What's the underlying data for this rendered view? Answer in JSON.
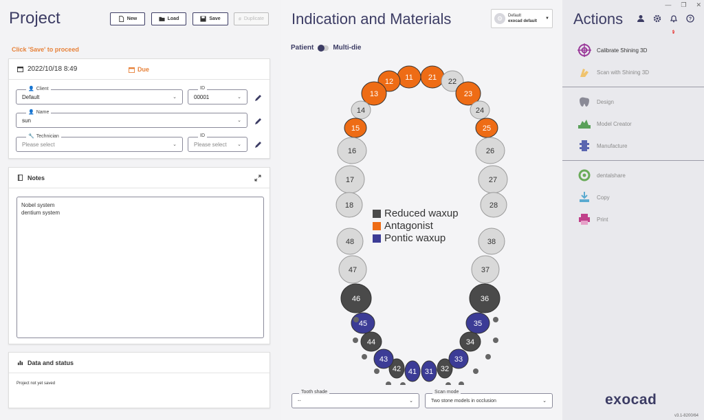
{
  "window": {
    "restore_glyph": "❐",
    "close_glyph": "✕"
  },
  "project": {
    "title": "Project",
    "buttons": {
      "new": "New",
      "load": "Load",
      "save": "Save",
      "duplicate": "Duplicate"
    },
    "hint": "Click 'Save' to proceed",
    "date": "2022/10/18 8:49",
    "due": "Due",
    "client_label": "Client",
    "client_value": "Default",
    "client_id_label": "ID",
    "client_id_value": "00001",
    "name_label": "Name",
    "name_value": "sun",
    "technician_label": "Technician",
    "technician_placeholder": "Please select",
    "technician_id_label": "ID",
    "technician_id_placeholder": "Please select",
    "notes_title": "Notes",
    "notes_lines": [
      "Nobel system",
      "dentium system"
    ],
    "data_title": "Data and status",
    "status_text": "Project not yet saved"
  },
  "indication": {
    "title": "Indication and Materials",
    "profile_line1": "Default",
    "profile_line2": "exocad default",
    "toggle_left": "Patient",
    "toggle_right": "Multi-die",
    "legend": [
      {
        "label": "Reduced waxup",
        "color": "#4a4a4a"
      },
      {
        "label": "Antagonist",
        "color": "#ee6c15"
      },
      {
        "label": "Pontic waxup",
        "color": "#3c3c96"
      }
    ],
    "tooth_shade_label": "Tooth shade",
    "tooth_shade_value": "--",
    "scan_mode_label": "Scan mode",
    "scan_mode_value": "Two stone models in occlusion",
    "colors": {
      "none": "#d9d9d9",
      "antagonist": "#ee6c15",
      "reduced": "#4a4a4a",
      "pontic": "#3c3c96"
    },
    "teeth": [
      {
        "n": "11",
        "state": "antagonist"
      },
      {
        "n": "12",
        "state": "antagonist"
      },
      {
        "n": "13",
        "state": "antagonist"
      },
      {
        "n": "14",
        "state": "none"
      },
      {
        "n": "15",
        "state": "antagonist"
      },
      {
        "n": "16",
        "state": "none"
      },
      {
        "n": "17",
        "state": "none"
      },
      {
        "n": "18",
        "state": "none"
      },
      {
        "n": "21",
        "state": "antagonist"
      },
      {
        "n": "22",
        "state": "none"
      },
      {
        "n": "23",
        "state": "antagonist"
      },
      {
        "n": "24",
        "state": "none"
      },
      {
        "n": "25",
        "state": "antagonist"
      },
      {
        "n": "26",
        "state": "none"
      },
      {
        "n": "27",
        "state": "none"
      },
      {
        "n": "28",
        "state": "none"
      },
      {
        "n": "31",
        "state": "pontic"
      },
      {
        "n": "32",
        "state": "reduced"
      },
      {
        "n": "33",
        "state": "pontic"
      },
      {
        "n": "34",
        "state": "reduced"
      },
      {
        "n": "35",
        "state": "pontic"
      },
      {
        "n": "36",
        "state": "reduced"
      },
      {
        "n": "37",
        "state": "none"
      },
      {
        "n": "38",
        "state": "none"
      },
      {
        "n": "41",
        "state": "pontic"
      },
      {
        "n": "42",
        "state": "reduced"
      },
      {
        "n": "43",
        "state": "pontic"
      },
      {
        "n": "44",
        "state": "reduced"
      },
      {
        "n": "45",
        "state": "pontic"
      },
      {
        "n": "46",
        "state": "reduced"
      },
      {
        "n": "47",
        "state": "none"
      },
      {
        "n": "48",
        "state": "none"
      }
    ]
  },
  "actions": {
    "title": "Actions",
    "items": [
      {
        "label": "Calibrate Shining 3D",
        "enabled": true
      },
      {
        "label": "Scan with Shining 3D",
        "enabled": false
      },
      {
        "label": "Design",
        "enabled": false
      },
      {
        "label": "Model Creator",
        "enabled": false
      },
      {
        "label": "Manufacture",
        "enabled": false
      },
      {
        "label": "dentalshare",
        "enabled": false
      },
      {
        "label": "Copy",
        "enabled": false
      },
      {
        "label": "Print",
        "enabled": false
      }
    ],
    "notification_count": "2",
    "brand": "exocad",
    "version": "v3.1-8200/64"
  }
}
